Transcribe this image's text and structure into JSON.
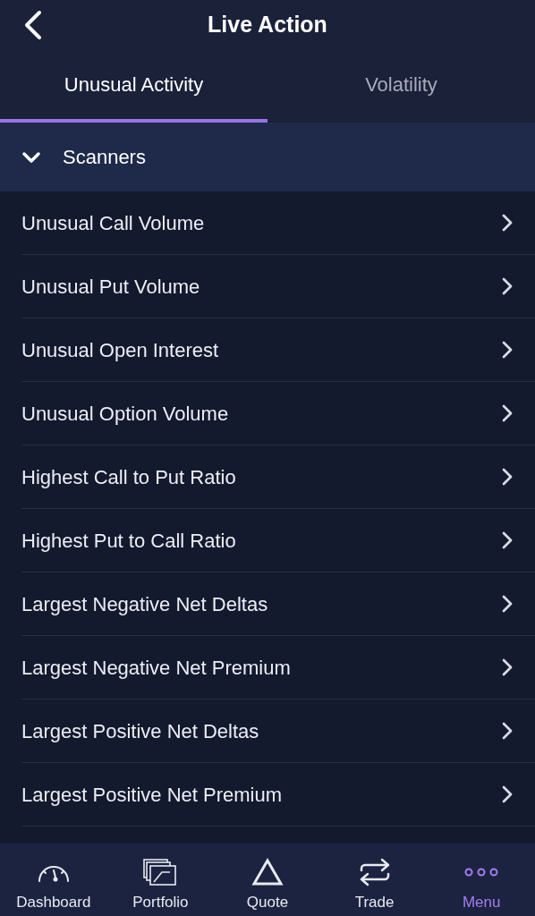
{
  "header": {
    "title": "Live Action"
  },
  "tabs": [
    {
      "label": "Unusual Activity",
      "selected": true
    },
    {
      "label": "Volatility",
      "selected": false
    }
  ],
  "section": {
    "label": "Scanners",
    "expanded": true
  },
  "items": [
    "Unusual Call Volume",
    "Unusual Put Volume",
    "Unusual Open Interest",
    "Unusual Option Volume",
    "Highest Call to Put Ratio",
    "Highest Put to Call Ratio",
    "Largest Negative Net Deltas",
    "Largest Negative Net Premium",
    "Largest Positive Net Deltas",
    "Largest Positive Net Premium"
  ],
  "nav": [
    {
      "kind": "dashboard",
      "label": "Dashboard",
      "selected": false
    },
    {
      "kind": "portfolio",
      "label": "Portfolio",
      "selected": false
    },
    {
      "kind": "quote",
      "label": "Quote",
      "selected": false
    },
    {
      "kind": "trade",
      "label": "Trade",
      "selected": false
    },
    {
      "kind": "menu",
      "label": "Menu",
      "selected": true
    }
  ]
}
